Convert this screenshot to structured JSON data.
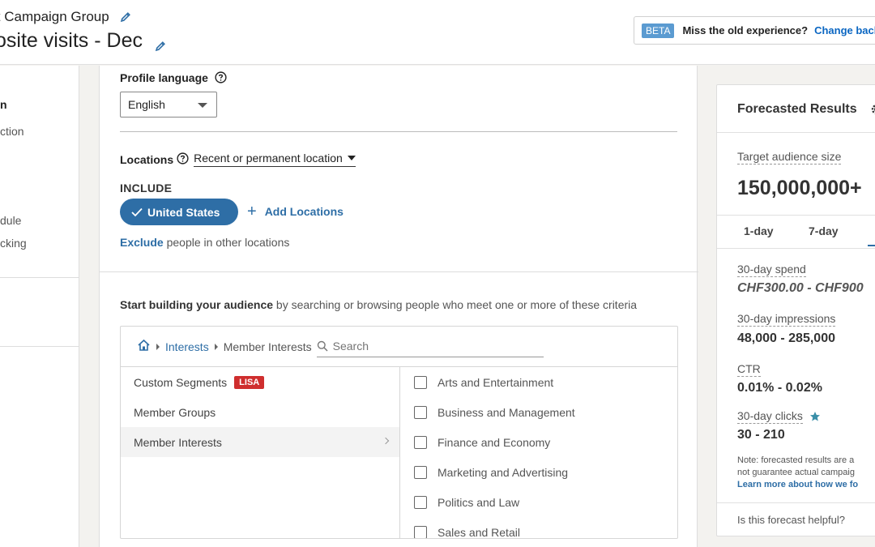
{
  "header": {
    "group_title": "lt Campaign Group",
    "campaign_title": "osite visits - Dec",
    "beta_badge": "BETA",
    "beta_text": "Miss the old experience?",
    "beta_link": "Change back"
  },
  "leftnav": {
    "items": [
      "n",
      "ction",
      "dule",
      "cking"
    ]
  },
  "targeting": {
    "profile_language_label": "Profile language",
    "profile_language_value": "English",
    "locations_label": "Locations",
    "location_type": "Recent or permanent location",
    "include_label": "INCLUDE",
    "included_location": "United States",
    "add_locations": "Add Locations",
    "exclude_link": "Exclude",
    "exclude_rest": " people in other locations"
  },
  "audience": {
    "build_bold": "Start building your audience",
    "build_rest": " by searching or browsing people who meet one or more of these criteria",
    "breadcrumb_link": "Interests",
    "breadcrumb_current": "Member Interests",
    "search_placeholder": "Search",
    "categories": [
      {
        "label": "Custom Segments",
        "badge": "LISA"
      },
      {
        "label": "Member Groups"
      },
      {
        "label": "Member Interests"
      }
    ],
    "options": [
      "Arts and Entertainment",
      "Business and Management",
      "Finance and Economy",
      "Marketing and Advertising",
      "Politics and Law",
      "Sales and Retail"
    ]
  },
  "forecast": {
    "title": "Forecasted Results",
    "audience_label": "Target audience size",
    "audience_value": "150,000,000+",
    "tabs": [
      "1-day",
      "7-day"
    ],
    "spend_label": "30-day spend",
    "spend_value": "CHF300.00 - CHF900",
    "impressions_label": "30-day impressions",
    "impressions_value": "48,000 - 285,000",
    "ctr_label": "CTR",
    "ctr_value": "0.01% - 0.02%",
    "clicks_label": "30-day clicks",
    "clicks_value": "30 - 210",
    "note_line1": "Note: forecasted results are a",
    "note_line2": "not guarantee actual campaig",
    "note_link": "Learn more about how we fo",
    "helpful": "Is this forecast helpful?"
  },
  "colors": {
    "accent": "#2e6ea6",
    "badge_red": "#cf2e2e",
    "beta_blue": "#5b9bd1"
  }
}
